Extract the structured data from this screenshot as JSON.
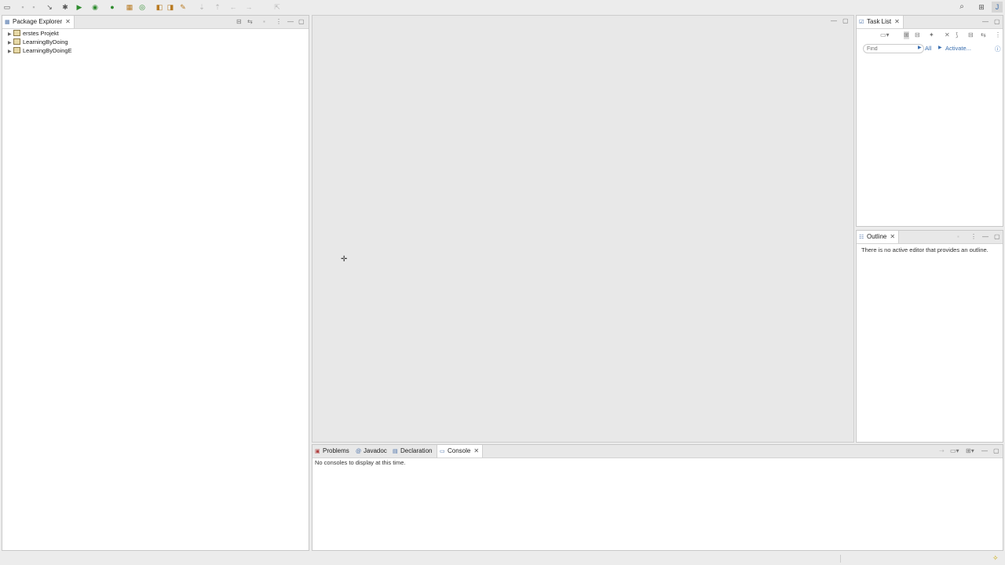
{
  "toolbar": {
    "icons": [
      "new-file-icon",
      "save-icon",
      "save-all-icon",
      "debug-icon",
      "run-icon",
      "coverage-icon",
      "run-external-icon",
      "new-java-project-icon",
      "new-class-icon",
      "open-type-icon",
      "open-task-icon",
      "search-icon-toolbar",
      "back-icon",
      "forward-icon",
      "search-icon",
      "perspective-icon",
      "java-perspective-icon"
    ]
  },
  "package_explorer": {
    "title": "Package Explorer",
    "items": [
      {
        "label": "erstes Projekt"
      },
      {
        "label": "LearningByDoing"
      },
      {
        "label": "LearningByDoingE"
      }
    ]
  },
  "task_list": {
    "title": "Task List",
    "find_placeholder": "Find",
    "all_label": "All",
    "activate_label": "Activate..."
  },
  "outline": {
    "title": "Outline",
    "message": "There is no active editor that provides an outline."
  },
  "console_area": {
    "tabs": [
      {
        "label": "Problems"
      },
      {
        "label": "Javadoc"
      },
      {
        "label": "Declaration"
      },
      {
        "label": "Console"
      }
    ],
    "message": "No consoles to display at this time."
  },
  "glyphs": {
    "arrow": "▶",
    "close": "✕",
    "min": "—",
    "max": "▢",
    "menu": "⋮",
    "cursor": "✛"
  }
}
